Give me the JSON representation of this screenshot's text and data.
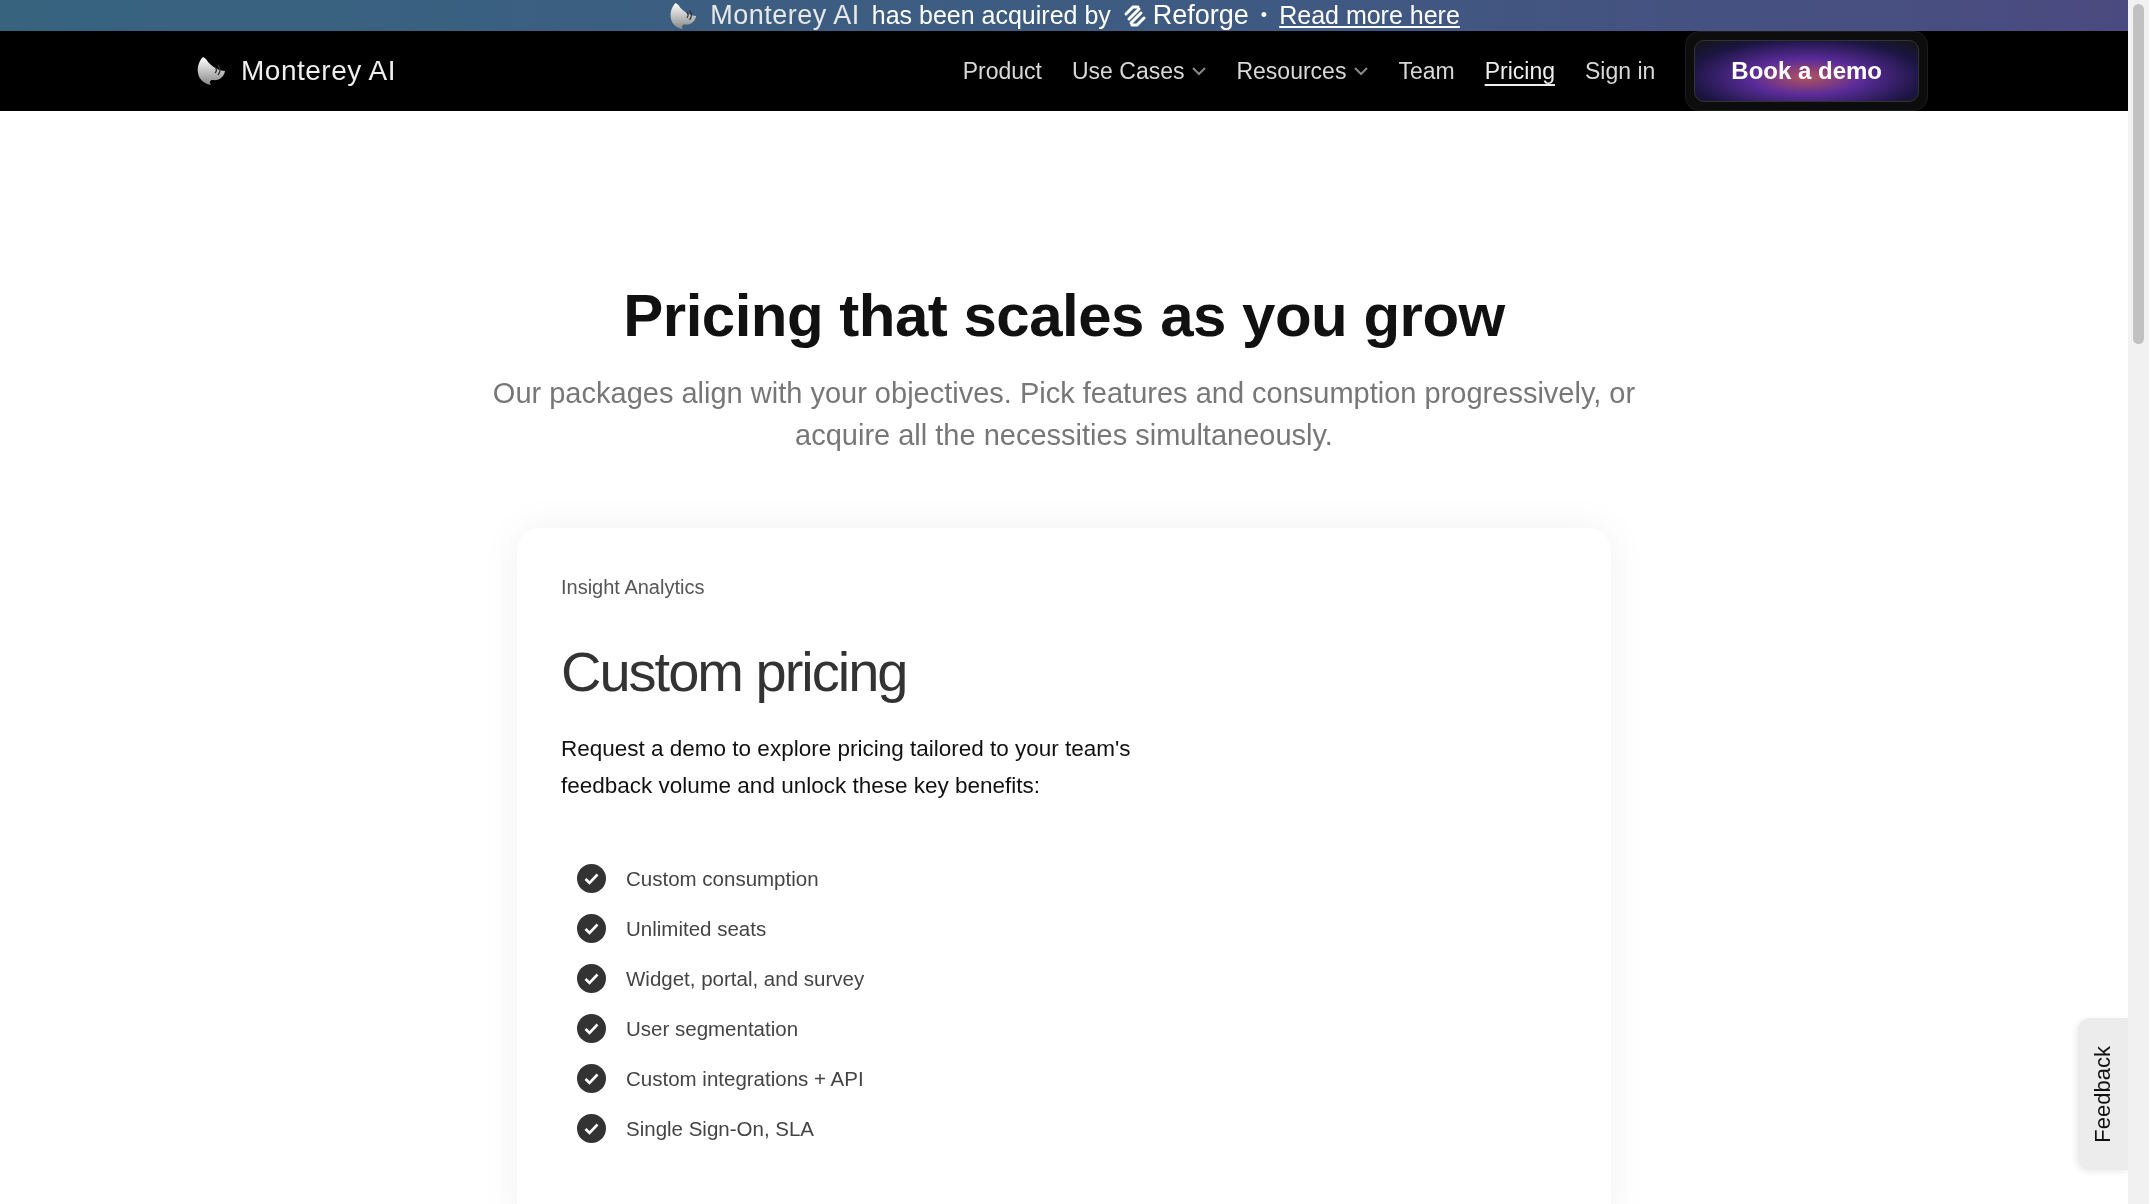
{
  "announcement": {
    "brand": "Monterey AI",
    "text": "has been acquired by",
    "partner": "Reforge",
    "separator": "•",
    "link": "Read more here"
  },
  "navbar": {
    "brand": "Monterey AI",
    "items": [
      {
        "label": "Product",
        "kind": "link",
        "selected": false
      },
      {
        "label": "Use Cases",
        "kind": "dropdown",
        "selected": false
      },
      {
        "label": "Resources",
        "kind": "dropdown",
        "selected": false
      },
      {
        "label": "Team",
        "kind": "link",
        "selected": false
      },
      {
        "label": "Pricing",
        "kind": "link",
        "selected": true
      },
      {
        "label": "Sign in",
        "kind": "link",
        "selected": false
      }
    ],
    "cta": "Book a demo"
  },
  "hero": {
    "title": "Pricing that scales as you grow",
    "subtitle": "Our packages align with your objectives. Pick features and consumption progressively, or acquire all the necessities simultaneously."
  },
  "plan_card": {
    "eyebrow": "Insight Analytics",
    "title": "Custom pricing",
    "description": "Request a demo to explore pricing tailored to your team's feedback volume and unlock these key benefits:",
    "features": [
      "Custom consumption",
      "Unlimited seats",
      "Widget, portal, and survey",
      "User segmentation",
      "Custom integrations + API",
      "Single Sign-On, SLA"
    ]
  },
  "feedback_tab": "Feedback"
}
